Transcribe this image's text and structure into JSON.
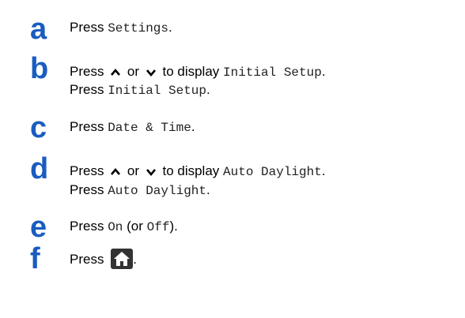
{
  "steps": [
    {
      "letter": "a",
      "lines": [
        {
          "w1": "Press ",
          "m1": "Settings",
          "w2": "."
        }
      ]
    },
    {
      "letter": "b",
      "lines": [
        {
          "w1": "Press ",
          "w2": " or ",
          "w3": " to display ",
          "m1": "Initial Setup",
          "w4": "."
        },
        {
          "w1": "Press ",
          "m1": "Initial Setup",
          "w2": "."
        }
      ]
    },
    {
      "letter": "c",
      "lines": [
        {
          "w1": "Press ",
          "m1": "Date & Time",
          "w2": "."
        }
      ]
    },
    {
      "letter": "d",
      "lines": [
        {
          "w1": "Press ",
          "w2": " or ",
          "w3": " to display ",
          "m1": "Auto Daylight",
          "w4": "."
        },
        {
          "w1": "Press ",
          "m1": "Auto Daylight",
          "w2": "."
        }
      ]
    },
    {
      "letter": "e",
      "lines": [
        {
          "w1": "Press ",
          "m1": "On",
          "w2": " (or ",
          "m2": "Off",
          "w3": ")."
        }
      ]
    },
    {
      "letter": "f",
      "lines": [
        {
          "w1": "Press ",
          "w2": "."
        }
      ]
    }
  ],
  "icons": {
    "up": "chevron-up-icon",
    "down": "chevron-down-icon",
    "home": "home-icon"
  },
  "colors": {
    "step_letter": "#1a5cc0",
    "text": "#000000",
    "home_button_bg": "#333333"
  }
}
